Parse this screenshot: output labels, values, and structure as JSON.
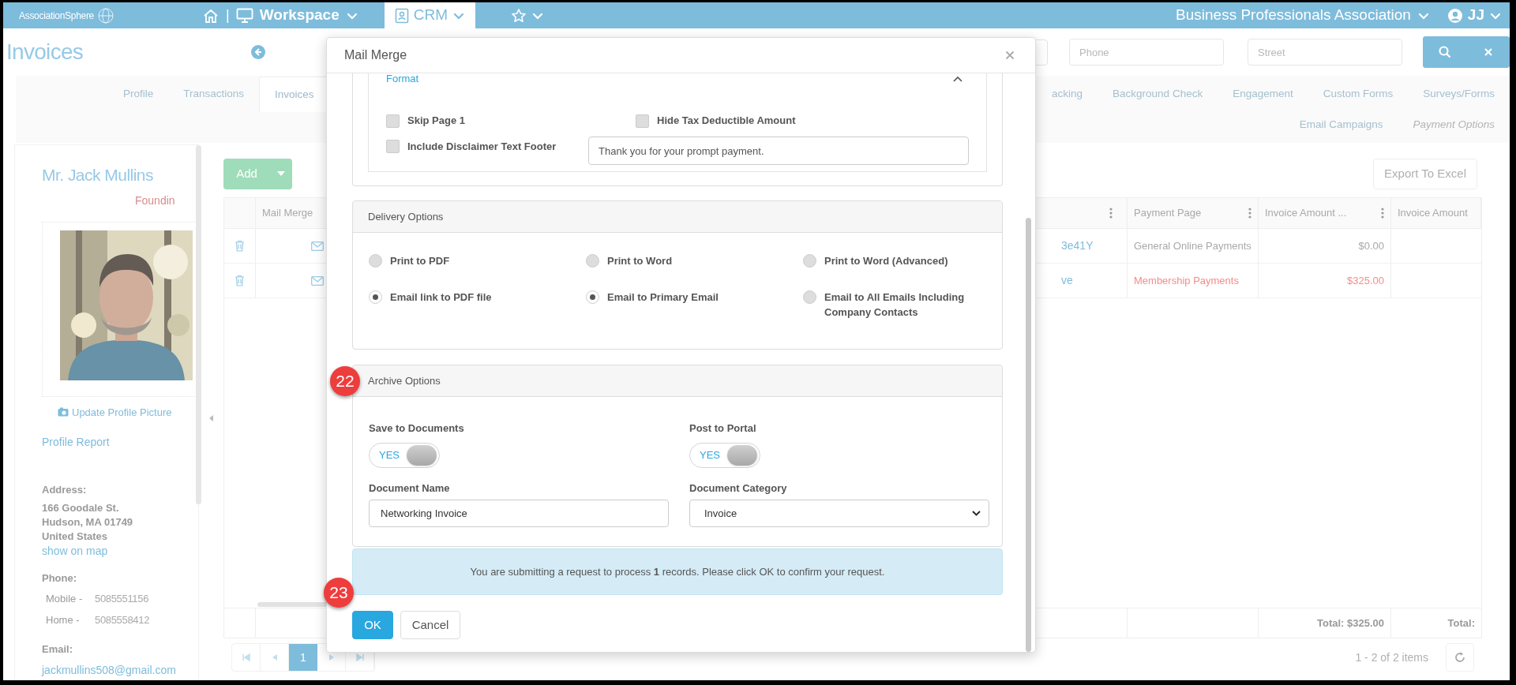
{
  "top_bar": {
    "logo": "AssociationSphere",
    "separator": "|",
    "workspace": "Workspace",
    "module": "CRM",
    "organization": "Business Professionals Association",
    "user": "JJ"
  },
  "page_title": "Invoices",
  "search_fields": [
    {
      "placeholder": "Phone"
    },
    {
      "placeholder": "Street"
    }
  ],
  "tabs_left": [
    {
      "label": "Profile",
      "selected": false,
      "disabled": false
    },
    {
      "label": "Transactions",
      "selected": false,
      "disabled": false
    },
    {
      "label": "Invoices",
      "selected": true,
      "disabled": false
    }
  ],
  "tabs_right": [
    {
      "label": "acking",
      "selected": false,
      "disabled": false
    },
    {
      "label": "Background Check",
      "selected": false,
      "disabled": false
    },
    {
      "label": "Engagement",
      "selected": false,
      "disabled": false
    },
    {
      "label": "Custom Forms",
      "selected": false,
      "disabled": false
    },
    {
      "label": "Surveys/Forms",
      "selected": false,
      "disabled": false
    }
  ],
  "tabs_second_row": [
    {
      "label": "Email Campaigns",
      "selected": false,
      "disabled": false
    },
    {
      "label": "Payment Options",
      "selected": false,
      "disabled": true
    }
  ],
  "profile": {
    "name": "Mr. Jack Mullins",
    "role": "Foundin",
    "update_picture": "Update Profile Picture",
    "report_link": "Profile Report",
    "address_label": "Address:",
    "address_lines": [
      "166 Goodale St.",
      "Hudson, MA 01749",
      "United States"
    ],
    "map_link": "show on map",
    "phone_label": "Phone:",
    "phones": [
      {
        "label": "Mobile -",
        "number": "5085551156"
      },
      {
        "label": "Home -",
        "number": "5085558412"
      }
    ],
    "email_label": "Email:",
    "email": "jackmullins508@gmail.com"
  },
  "grid": {
    "add_button": "Add",
    "export_button": "Export To Excel",
    "columns": [
      "Mail Merge",
      "Payment Page",
      "Invoice Amount ...",
      "Invoice Amount"
    ],
    "rows": [
      {
        "link": "3e41Y",
        "payment_page": "General Online Payments",
        "amount": "$0.00",
        "highlighted": false
      },
      {
        "link": "ve",
        "payment_page": "Membership Payments",
        "amount": "$325.00",
        "highlighted": true
      }
    ],
    "totals": [
      "Total: $325.00",
      "Total:"
    ],
    "pages": [
      {
        "label": "1",
        "selected": true
      }
    ],
    "summary": "1 - 2 of 2 items"
  },
  "mail_merge": {
    "title": "Mail Merge",
    "section_link": "Format",
    "checkboxes": [
      {
        "label": "Skip Page 1",
        "checked": false
      },
      {
        "label": "Hide Tax Deductible Amount",
        "checked": false
      },
      {
        "label": "Include Disclaimer Text Footer",
        "checked": false
      }
    ],
    "disclaimer_value": "Thank you for your prompt payment.",
    "delivery": {
      "title": "Delivery Options",
      "options": [
        {
          "label": "Print to PDF",
          "selected": false
        },
        {
          "label": "Print to Word",
          "selected": false
        },
        {
          "label": "Print to Word (Advanced)",
          "selected": false
        },
        {
          "label": "Email link to PDF file",
          "selected": true
        },
        {
          "label": "Email to Primary Email",
          "selected": true
        },
        {
          "label": "Email to All Emails Including Company Contacts",
          "selected": false
        }
      ]
    },
    "archive": {
      "title": "Archive Options",
      "toggles": [
        {
          "label": "Save to Documents",
          "value": "YES",
          "on": true
        },
        {
          "label": "Post to Portal",
          "value": "YES",
          "on": true
        }
      ],
      "document_name": {
        "label": "Document Name",
        "value": "Networking Invoice"
      },
      "document_category": {
        "label": "Document Category",
        "value": "Invoice"
      }
    },
    "alert": "You are submitting a request to process **1** records. Please click OK to confirm your request.",
    "buttons": [
      {
        "label": "OK",
        "kind": "primary"
      },
      {
        "label": "Cancel",
        "kind": "secondary"
      }
    ]
  },
  "callouts": [
    "22",
    "23"
  ]
}
